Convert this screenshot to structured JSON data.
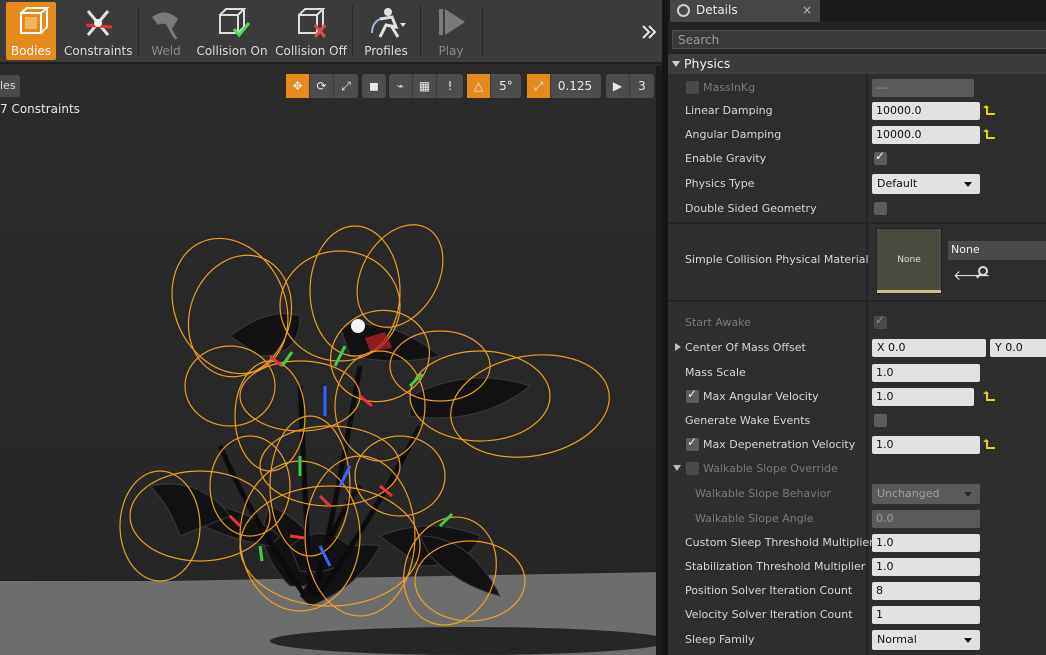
{
  "toolbar": {
    "items": [
      {
        "label": "Bodies",
        "icon": "bodies-icon",
        "state": "active"
      },
      {
        "label": "Constraints",
        "icon": "constraints-icon",
        "state": "normal"
      },
      {
        "label": "Weld",
        "icon": "weld-icon",
        "state": "disabled"
      },
      {
        "label": "Collision On",
        "icon": "collision-on-icon",
        "state": "normal"
      },
      {
        "label": "Collision Off",
        "icon": "collision-off-icon",
        "state": "normal"
      },
      {
        "label": "Profiles",
        "icon": "profiles-icon",
        "state": "normal"
      },
      {
        "label": "Play",
        "icon": "play-icon",
        "state": "disabled"
      }
    ],
    "overflow_icon": "double-chevron-right-icon",
    "accent": "#e58a1c"
  },
  "viewport": {
    "tab_label": "les",
    "info_text": "7 Constraints",
    "grid_snap": "0.125",
    "rotation_snap": "5°",
    "camera_speed": "3",
    "floor_color": "#6d6d6d",
    "wire_color": "#f5a623"
  },
  "details": {
    "tab_title": "Details",
    "close_glyph": "×",
    "search_placeholder": "Search",
    "category": "Physics",
    "mass_in_kg_label": "MassInKg",
    "mass_in_kg_value": "---",
    "linear_damping_label": "Linear Damping",
    "linear_damping_value": "10000.0",
    "angular_damping_label": "Angular Damping",
    "angular_damping_value": "10000.0",
    "enable_gravity_label": "Enable Gravity",
    "physics_type_label": "Physics Type",
    "physics_type_value": "Default",
    "double_sided_label": "Double Sided Geometry",
    "simple_collision_label": "Simple Collision Physical Material",
    "material_thumb_text": "None",
    "material_name": "None",
    "start_awake_label": "Start Awake",
    "com_offset_label": "Center Of Mass Offset",
    "com_x": "X  0.0",
    "com_y": "Y  0.0",
    "mass_scale_label": "Mass Scale",
    "mass_scale_value": "1.0",
    "max_angular_velocity_label": "Max Angular Velocity",
    "max_angular_velocity_value": "1.0",
    "generate_wake_label": "Generate Wake Events",
    "max_depen_label": "Max Depenetration Velocity",
    "max_depen_value": "1.0",
    "walkable_override_label": "Walkable Slope Override",
    "walkable_behavior_label": "Walkable Slope Behavior",
    "walkable_behavior_value": "Unchanged",
    "walkable_angle_label": "Walkable Slope Angle",
    "walkable_angle_value": "0.0",
    "sleep_thresh_label": "Custom Sleep Threshold Multiplier",
    "sleep_thresh_value": "1.0",
    "stab_thresh_label": "Stabilization Threshold Multiplier",
    "stab_thresh_value": "1.0",
    "pos_iter_label": "Position Solver Iteration Count",
    "pos_iter_value": "8",
    "vel_iter_label": "Velocity Solver Iteration Count",
    "vel_iter_value": "1",
    "sleep_family_label": "Sleep Family",
    "sleep_family_value": "Normal",
    "reset_color": "#e4d100"
  }
}
